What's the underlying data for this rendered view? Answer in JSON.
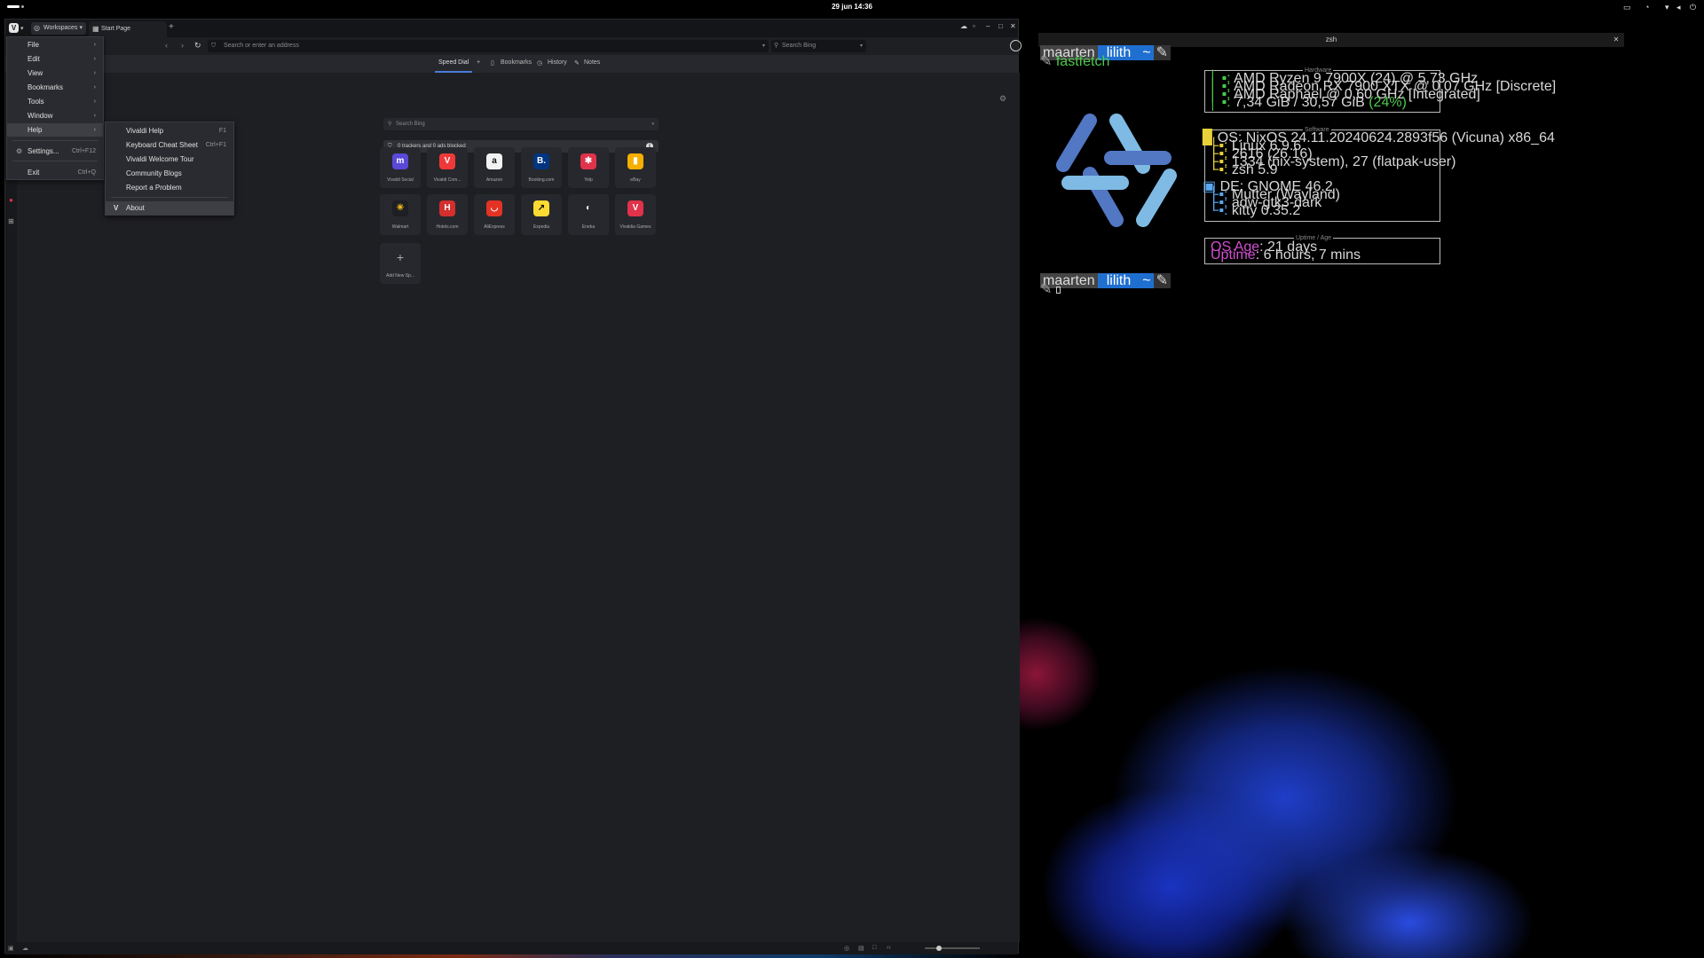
{
  "topbar": {
    "clock": "29 jun  14:36"
  },
  "browser": {
    "workspaces_label": "Workspaces",
    "tab_title": "Start Page",
    "url_placeholder": "Search or enter an address",
    "search_placeholder": "Search Bing",
    "startpage_tabs": [
      "Speed Dial",
      "Bookmarks",
      "History",
      "Notes"
    ],
    "sd_search_placeholder": "Search Bing",
    "tracker_text": "0 trackers and 0 ads blocked",
    "speed_dials": [
      {
        "label": "Vivaldi Social",
        "glyph": "m",
        "color": "#5a48d8"
      },
      {
        "label": "Vivaldi Com...",
        "glyph": "V",
        "color": "#ef3939"
      },
      {
        "label": "Amazon",
        "glyph": "a",
        "color": "#f2f2f2"
      },
      {
        "label": "Booking.com",
        "glyph": "B.",
        "color": "#003580"
      },
      {
        "label": "Yelp",
        "glyph": "✱",
        "color": "#e0324a"
      },
      {
        "label": "eBay",
        "glyph": "▮",
        "color": "#f5af02"
      },
      {
        "label": "Walmart",
        "glyph": "✳",
        "color": "#1e1f23"
      },
      {
        "label": "Hotels.com",
        "glyph": "H",
        "color": "#d32f2f"
      },
      {
        "label": "AliExpress",
        "glyph": "◡",
        "color": "#e43225"
      },
      {
        "label": "Expedia",
        "glyph": "↗",
        "color": "#fddb32"
      },
      {
        "label": "Eneba",
        "glyph": "◐",
        "color": "#27282d"
      },
      {
        "label": "Vivaldia Games",
        "glyph": "V",
        "color": "#e0324a"
      }
    ],
    "add_new_label": "Add New Sp...",
    "icons": {
      "back": "chevron-left-icon",
      "forward": "chevron-right-icon",
      "reload": "reload-icon",
      "shield": "shield-icon",
      "search": "search-icon",
      "profile": "profile-icon",
      "settings": "gear-icon"
    }
  },
  "main_menu": {
    "items": [
      {
        "label": "File"
      },
      {
        "label": "Edit"
      },
      {
        "label": "View"
      },
      {
        "label": "Bookmarks"
      },
      {
        "label": "Tools"
      },
      {
        "label": "Window"
      },
      {
        "label": "Help"
      }
    ],
    "settings_label": "Settings...",
    "settings_shortcut": "Ctrl+F12",
    "exit_label": "Exit",
    "exit_shortcut": "Ctrl+Q"
  },
  "help_menu": {
    "items": [
      {
        "label": "Vivaldi Help",
        "shortcut": "F1"
      },
      {
        "label": "Keyboard Cheat Sheet",
        "shortcut": "Ctrl+F1"
      },
      {
        "label": "Vivaldi Welcome Tour",
        "shortcut": ""
      },
      {
        "label": "Community Blogs",
        "shortcut": ""
      },
      {
        "label": "Report a Problem",
        "shortcut": ""
      }
    ],
    "about_label": "About"
  },
  "terminal": {
    "title": "zsh",
    "prompt_user": "maarten",
    "prompt_host": "lilith",
    "prompt_dir": "~",
    "command": "fastfetch",
    "hardware_title": "Hardware",
    "hardware": [
      "AMD Ryzen 9 7900X (24) @ 5,73 GHz",
      "AMD Radeon RX 7900 XTX @ 0,07 GHz [Discrete]",
      "AMD Raphael @ 0,60 GHz [Integrated]",
      "7,34 GiB / 30,57 GiB"
    ],
    "mem_pct": "(24%)",
    "software_title": "Software",
    "software_os": "OS: NixOS 24.11.20240624.2893f56 (Vicuna) x86_64",
    "software": [
      "Linux 6.9.6",
      "2616 (26.16)",
      "1334 (nix-system), 27 (flatpak-user)",
      "zsh 5.9"
    ],
    "de": "DE: GNOME 46.2",
    "desktop": [
      "Mutter (Wayland)",
      "adw-gtk3-dark",
      "kitty 0.35.2"
    ],
    "uptime_title": "Uptime / Age",
    "os_age_key": "OS Age",
    "os_age_val": ": 21 days",
    "uptime_key": "Uptime",
    "uptime_val": ": 6 hours, 7 mins"
  }
}
